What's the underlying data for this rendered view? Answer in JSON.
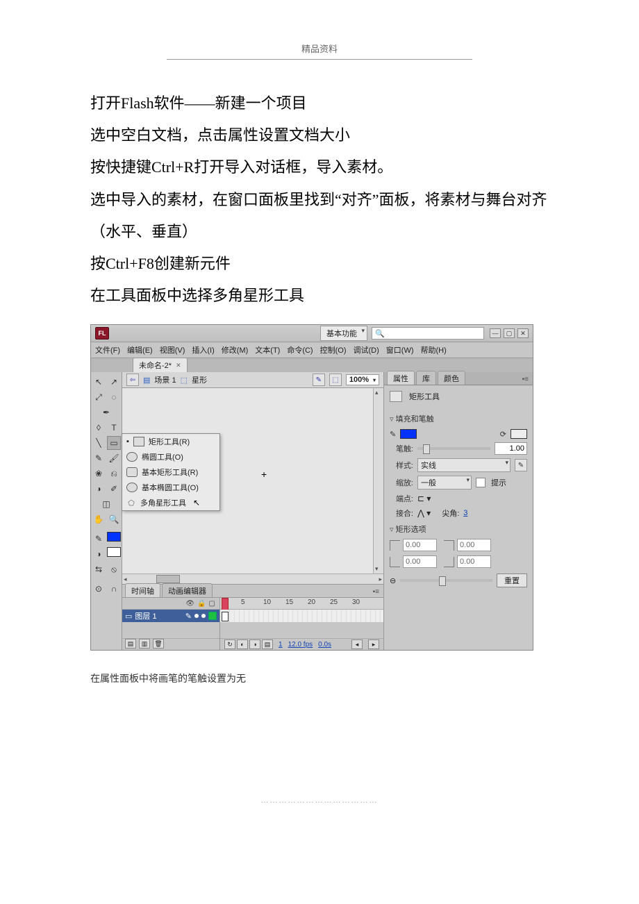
{
  "header": {
    "title": "精品资料"
  },
  "body": {
    "p1": "打开Flash软件——新建一个项目",
    "p2": "选中空白文档，点击属性设置文档大小",
    "p3": "按快捷键Ctrl+R打开导入对话框，导入素材。",
    "p4": "选中导入的素材，在窗口面板里找到“对齐”面板，将素材与舞台对齐（水平、垂直）",
    "p5": "按Ctrl+F8创建新元件",
    "p6": "在工具面板中选择多角星形工具"
  },
  "footnote": "在属性面板中将画笔的笔触设置为无",
  "footer": "…………………………………",
  "app": {
    "logo": "FL",
    "workspace_dropdown": "基本功能",
    "menus": {
      "file": "文件(F)",
      "edit": "编辑(E)",
      "view": "视图(V)",
      "insert": "插入(I)",
      "modify": "修改(M)",
      "text": "文本(T)",
      "commands": "命令(C)",
      "control": "控制(O)",
      "debug": "调试(D)",
      "window": "窗口(W)",
      "help": "帮助(H)"
    },
    "doc_tab": "未命名-2*",
    "breadcrumb": {
      "scene": "场景 1",
      "symbol": "星形"
    },
    "zoom": "100%",
    "shape_flyout": {
      "rect": "矩形工具(R)",
      "oval": "椭圆工具(O)",
      "prim_rect": "基本矩形工具(R)",
      "prim_oval": "基本椭圆工具(O)",
      "polystar": "多角星形工具"
    },
    "props": {
      "tabs": {
        "properties": "属性",
        "library": "库",
        "swatches": "颜色"
      },
      "tool_name": "矩形工具",
      "section_fillstroke": "填充和笔触",
      "stroke_label": "笔触:",
      "stroke_value": "1.00",
      "style_label": "样式:",
      "style_value": "实线",
      "scale_label": "缩放:",
      "scale_value": "一般",
      "hint_label": "提示",
      "cap_label": "端点:",
      "join_label": "接合:",
      "miter_label": "尖角:",
      "miter_value": "3",
      "section_rect": "矩形选项",
      "corner": "0.00",
      "reset": "重置"
    },
    "timeline": {
      "tabs": {
        "timeline": "时间轴",
        "motion": "动画编辑器"
      },
      "layer": "图层 1",
      "ticks": [
        "5",
        "10",
        "15",
        "20",
        "25",
        "30"
      ],
      "frame": "1",
      "fps": "12.0 fps",
      "time": "0.0s"
    }
  }
}
